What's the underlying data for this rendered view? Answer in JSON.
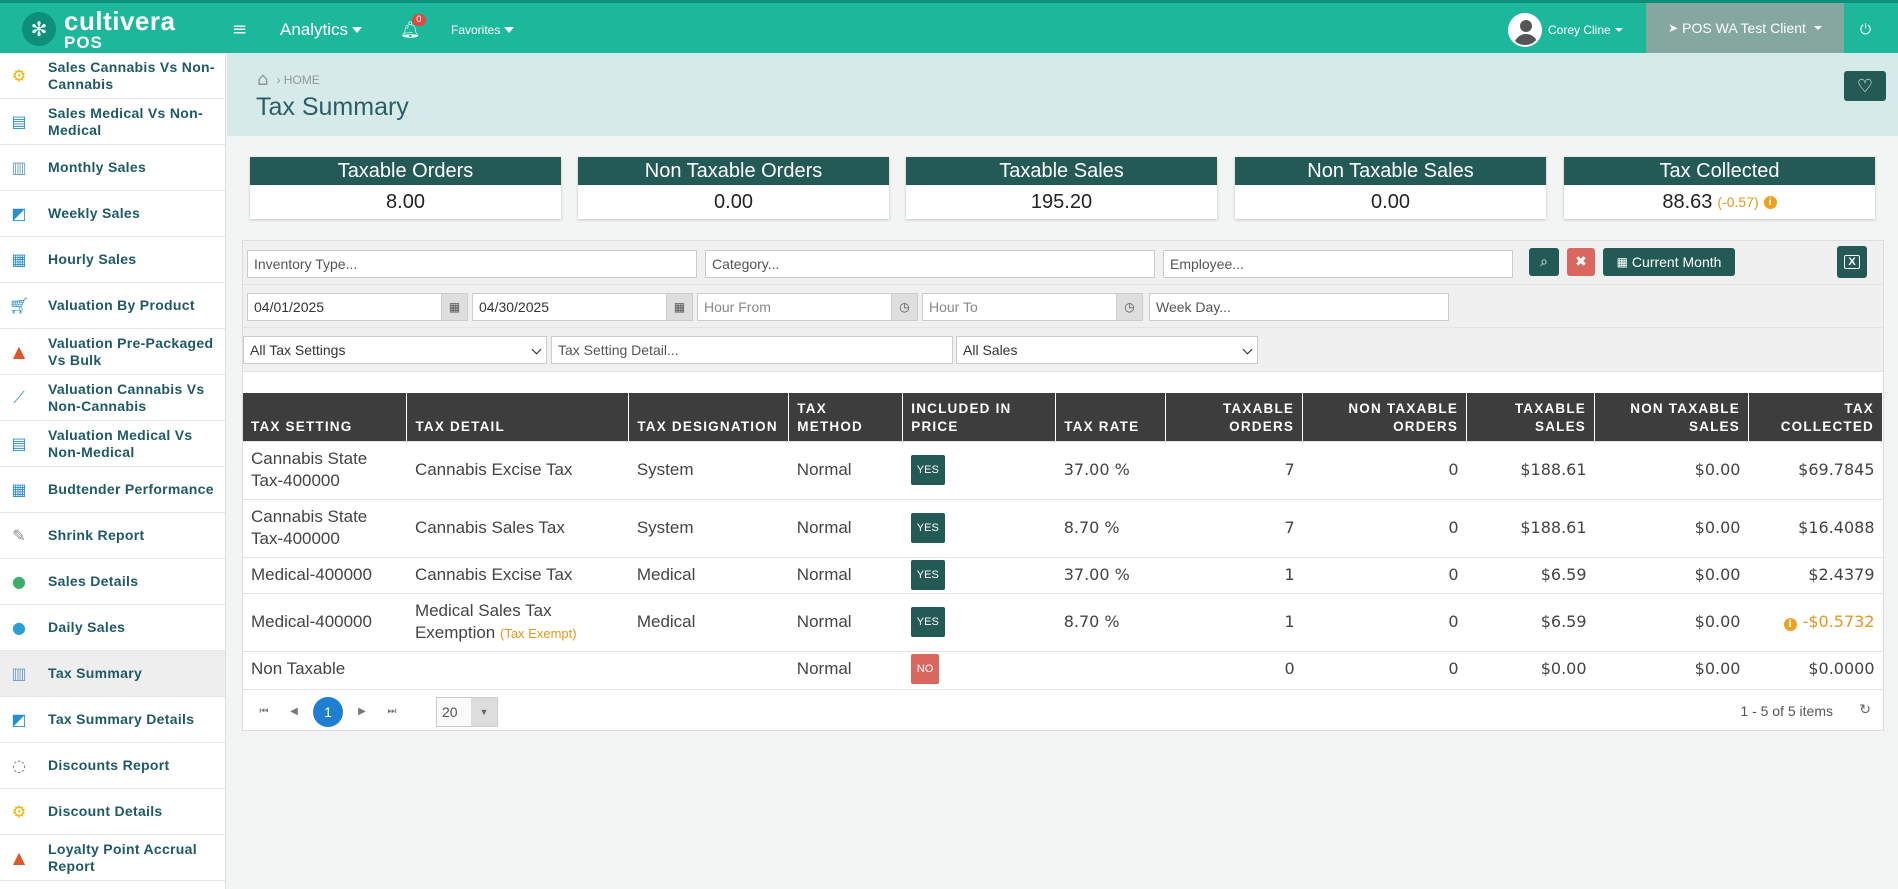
{
  "app": {
    "logo_line1": "cultivera",
    "logo_line2": "POS"
  },
  "topnav": {
    "menu_icon": "hamburger-icon",
    "analytics_label": "Analytics",
    "notification_count": "0",
    "favorites_label": "Favorites",
    "user_name": "Corey Cline",
    "client_name": "POS WA Test Client"
  },
  "sidebar": {
    "items": [
      {
        "label": "Sales Cannabis Vs Non-Cannabis",
        "icon": "org-chart-icon"
      },
      {
        "label": "Sales Medical Vs Non-Medical",
        "icon": "clipboard-icon"
      },
      {
        "label": "Monthly Sales",
        "icon": "bar-chart-icon"
      },
      {
        "label": "Weekly Sales",
        "icon": "line-chart-icon"
      },
      {
        "label": "Hourly Sales",
        "icon": "presentation-icon"
      },
      {
        "label": "Valuation By Product",
        "icon": "cart-icon"
      },
      {
        "label": "Valuation Pre-Packaged Vs Bulk",
        "icon": "triangle-icon"
      },
      {
        "label": "Valuation Cannabis Vs Non-Cannabis",
        "icon": "trend-icon"
      },
      {
        "label": "Valuation Medical Vs Non-Medical",
        "icon": "clipboard-icon"
      },
      {
        "label": "Budtender Performance",
        "icon": "presentation-icon"
      },
      {
        "label": "Shrink Report",
        "icon": "pencil-chart-icon"
      },
      {
        "label": "Sales Details",
        "icon": "growth-icon"
      },
      {
        "label": "Daily Sales",
        "icon": "swap-icon"
      },
      {
        "label": "Tax Summary",
        "icon": "bar-chart-icon"
      },
      {
        "label": "Tax Summary Details",
        "icon": "line-chart-icon"
      },
      {
        "label": "Discounts Report",
        "icon": "donut-icon"
      },
      {
        "label": "Discount Details",
        "icon": "org-chart-icon"
      },
      {
        "label": "Loyalty Point Accrual Report",
        "icon": "triangle-icon"
      }
    ]
  },
  "header": {
    "breadcrumb": "› HOME",
    "title": "Tax Summary"
  },
  "stats": [
    {
      "title": "Taxable Orders",
      "value": "8.00",
      "sub": ""
    },
    {
      "title": "Non Taxable Orders",
      "value": "0.00",
      "sub": ""
    },
    {
      "title": "Taxable Sales",
      "value": "195.20",
      "sub": ""
    },
    {
      "title": "Non Taxable Sales",
      "value": "0.00",
      "sub": ""
    },
    {
      "title": "Tax Collected",
      "value": "88.63",
      "sub": "(-0.57)"
    }
  ],
  "filters": {
    "inventory_type": "Inventory Type...",
    "category": "Category...",
    "employee": "Employee...",
    "current_month_label": "Current Month",
    "date_from": "04/01/2025",
    "date_to": "04/30/2025",
    "hour_from": "Hour From",
    "hour_to": "Hour To",
    "week_day": "Week Day...",
    "tax_settings": "All Tax Settings",
    "tax_setting_detail": "Tax Setting Detail...",
    "sales": "All Sales"
  },
  "table": {
    "headers": [
      "TAX SETTING",
      "TAX DETAIL",
      "TAX DESIGNATION",
      "TAX METHOD",
      "INCLUDED IN PRICE",
      "TAX RATE",
      "TAXABLE ORDERS",
      "NON TAXABLE ORDERS",
      "TAXABLE SALES",
      "NON TAXABLE SALES",
      "TAX COLLECTED"
    ],
    "rows": [
      {
        "setting": "Cannabis State Tax-400000",
        "detail": "Cannabis Excise Tax",
        "detail_note": "",
        "designation": "System",
        "method": "Normal",
        "included": "YES",
        "rate": "37.00 %",
        "taxable_orders": "7",
        "non_taxable_orders": "0",
        "taxable_sales": "$188.61",
        "non_taxable_sales": "$0.00",
        "tax_collected": "$69.7845"
      },
      {
        "setting": "Cannabis State Tax-400000",
        "detail": "Cannabis Sales Tax",
        "detail_note": "",
        "designation": "System",
        "method": "Normal",
        "included": "YES",
        "rate": "8.70 %",
        "taxable_orders": "7",
        "non_taxable_orders": "0",
        "taxable_sales": "$188.61",
        "non_taxable_sales": "$0.00",
        "tax_collected": "$16.4088"
      },
      {
        "setting": "Medical-400000",
        "detail": "Cannabis Excise Tax",
        "detail_note": "",
        "designation": "Medical",
        "method": "Normal",
        "included": "YES",
        "rate": "37.00 %",
        "taxable_orders": "1",
        "non_taxable_orders": "0",
        "taxable_sales": "$6.59",
        "non_taxable_sales": "$0.00",
        "tax_collected": "$2.4379"
      },
      {
        "setting": "Medical-400000",
        "detail": "Medical Sales Tax Exemption",
        "detail_note": "(Tax Exempt)",
        "designation": "Medical",
        "method": "Normal",
        "included": "YES",
        "rate": "8.70 %",
        "taxable_orders": "1",
        "non_taxable_orders": "0",
        "taxable_sales": "$6.59",
        "non_taxable_sales": "$0.00",
        "tax_collected": "-$0.5732"
      },
      {
        "setting": "Non Taxable",
        "detail": "",
        "detail_note": "",
        "designation": "",
        "method": "Normal",
        "included": "NO",
        "rate": "",
        "taxable_orders": "0",
        "non_taxable_orders": "0",
        "taxable_sales": "$0.00",
        "non_taxable_sales": "$0.00",
        "tax_collected": "$0.0000"
      }
    ]
  },
  "pager": {
    "current_page": "1",
    "page_size": "20",
    "info": "1 - 5 of 5 items"
  },
  "colors": {
    "brand": "#1db79b",
    "dark_teal": "#245a55",
    "header_bg": "#d6ebe9",
    "table_header": "#3d3d3d",
    "warning": "#e6971f",
    "danger": "#d9675e"
  }
}
